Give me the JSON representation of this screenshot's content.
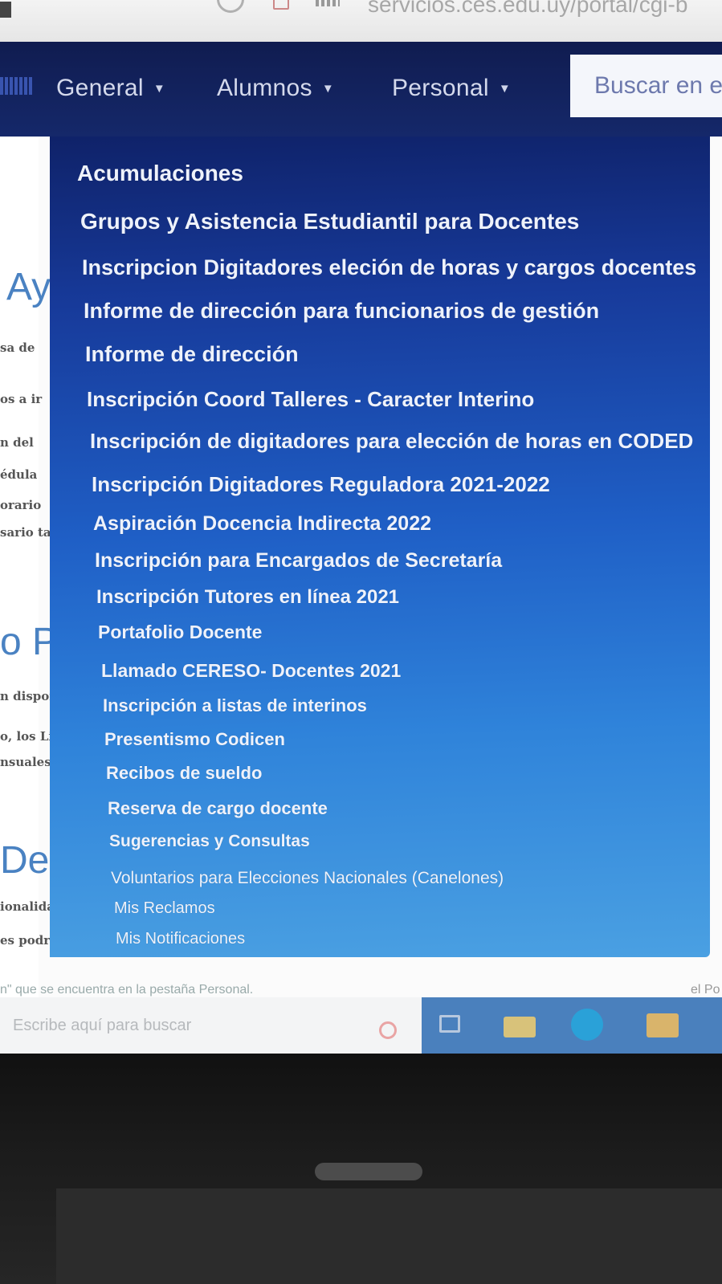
{
  "browser": {
    "url": "servicios.ces.edu.uy/portal/cgi-b"
  },
  "navbar": {
    "items": [
      {
        "label": "General",
        "caret": "▼"
      },
      {
        "label": "Alumnos",
        "caret": "▼"
      },
      {
        "label": "Personal",
        "caret": "▼"
      }
    ],
    "search_placeholder": "Buscar en el"
  },
  "background_page": {
    "headings": [
      "Ay",
      "o Pr",
      "Desi"
    ],
    "fragments": [
      "sa de",
      "os a ir",
      "n del",
      "édula",
      "orario",
      "sario ta",
      "n dispon",
      "o, los Lic",
      "nsuales v",
      "ionalidad",
      "es podrán"
    ],
    "footer_text": "n\" que se encuentra en la pestaña Personal.",
    "footer_right": "el Po"
  },
  "dropdown": {
    "items": [
      "Acumulaciones",
      "Grupos y Asistencia Estudiantil para Docentes",
      "Inscripcion Digitadores eleción de horas y cargos docentes",
      "Informe de dirección para funcionarios de gestión",
      "Informe de dirección",
      "Inscripción Coord Talleres - Caracter Interino",
      "Inscripción de digitadores para elección de horas en CODED",
      "Inscripción Digitadores Reguladora 2021-2022",
      "Aspiración Docencia Indirecta 2022",
      "Inscripción para Encargados de Secretaría",
      "Inscripción Tutores en línea 2021",
      "Portafolio Docente",
      "Llamado CERESO- Docentes 2021",
      "Inscripción a listas de interinos",
      "Presentismo Codicen",
      "Recibos de sueldo",
      "Reserva de cargo docente",
      "Sugerencias y Consultas",
      "Voluntarios para Elecciones Nacionales (Canelones)",
      "Mis Reclamos",
      "Mis Notificaciones"
    ]
  },
  "taskbar": {
    "search_placeholder": "Escribe aquí para buscar"
  },
  "colors": {
    "navbar": "#12205a",
    "dropdown_top": "#0f2269",
    "dropdown_bottom": "#4aa0e2",
    "menu_text": "#eef2fb"
  }
}
